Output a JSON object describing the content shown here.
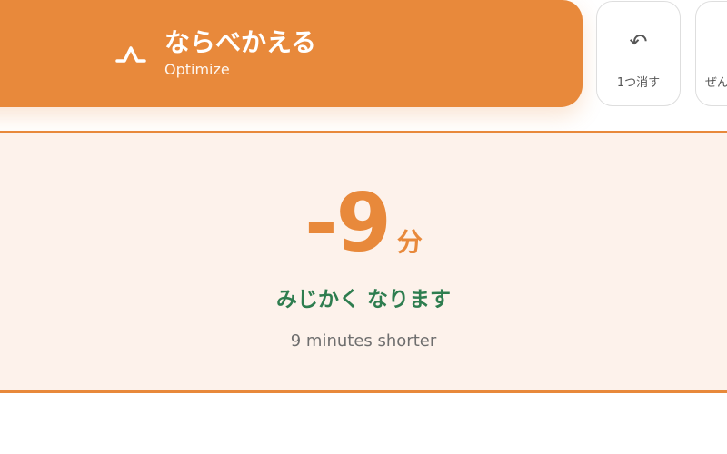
{
  "optimize": {
    "title": "ならべかえる",
    "subtitle": "Optimize",
    "icon": "route-peak-icon"
  },
  "toolbar": {
    "undo": {
      "icon": "↶",
      "label": "1つ消す"
    },
    "reset": {
      "label": "ぜん"
    }
  },
  "result": {
    "delta_value": "-9",
    "delta_unit": "分",
    "message_jp": "みじかく なります",
    "message_en": "9 minutes shorter"
  },
  "colors": {
    "accent": "#e8893b",
    "panel_background": "#fdf2eb",
    "message_green": "#2e7d4f",
    "muted_text": "#6e6e6e"
  }
}
